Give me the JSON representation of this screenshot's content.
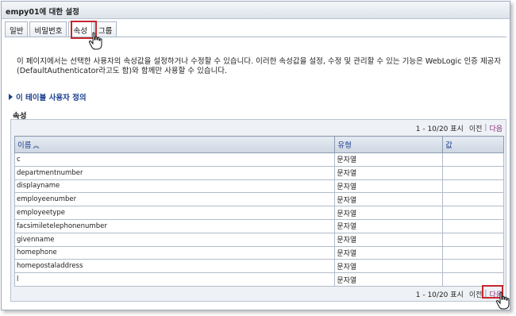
{
  "window": {
    "title": "empy01에 대한 설정"
  },
  "tabs": [
    {
      "label": "일반"
    },
    {
      "label": "비밀번호"
    },
    {
      "label": "속성",
      "active": true
    },
    {
      "label": "그룹"
    }
  ],
  "description": {
    "line1": "이 페이지에서는 선택한 사용자의 속성값을 설정하거나 수정할 수 있습니다. 이러한 속성값을 설정, 수정 및 관리할 수 있는 기능은 WebLogic 인증 제공자",
    "line2": "(DefaultAuthenticator라고도 함)와 함께만 사용할 수 있습니다."
  },
  "section_link": {
    "label": "이 테이블 사용자 정의",
    "icon": "expand-triangle-icon"
  },
  "attributes": {
    "title": "속성",
    "pager": {
      "range": "1 - 10/20 표시",
      "prev": "이전",
      "next": "다음"
    },
    "columns": {
      "name": "이름",
      "type": "유형",
      "value": "값"
    },
    "rows": [
      {
        "name": "c",
        "type": "문자열",
        "value": ""
      },
      {
        "name": "departmentnumber",
        "type": "문자열",
        "value": ""
      },
      {
        "name": "displayname",
        "type": "문자열",
        "value": ""
      },
      {
        "name": "employeenumber",
        "type": "문자열",
        "value": ""
      },
      {
        "name": "employeetype",
        "type": "문자열",
        "value": ""
      },
      {
        "name": "facsimiletelephonenumber",
        "type": "문자열",
        "value": ""
      },
      {
        "name": "givenname",
        "type": "문자열",
        "value": ""
      },
      {
        "name": "homephone",
        "type": "문자열",
        "value": ""
      },
      {
        "name": "homepostaladdress",
        "type": "문자열",
        "value": ""
      },
      {
        "name": "l",
        "type": "문자열",
        "value": ""
      }
    ]
  },
  "colors": {
    "link": "#1a3d8f",
    "next_link": "#8a2a78",
    "highlight": "#c6262e"
  }
}
